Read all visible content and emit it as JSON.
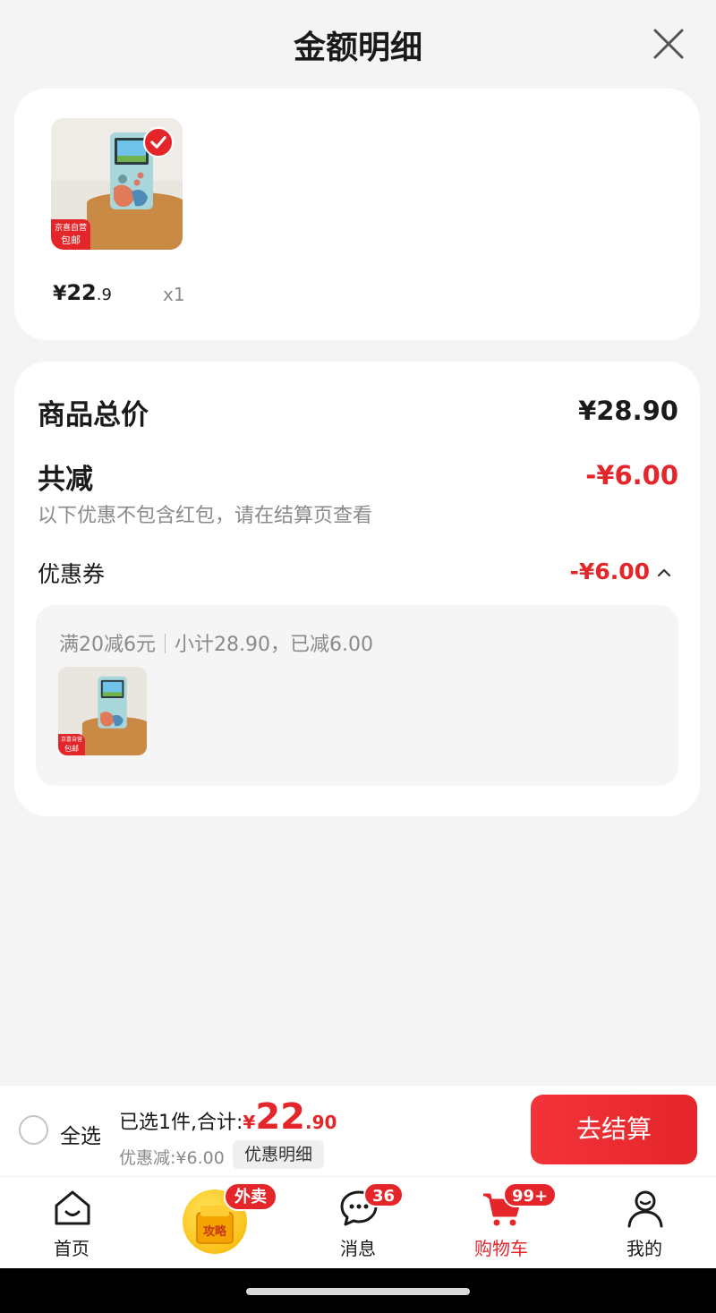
{
  "header": {
    "title": "金额明细",
    "close_icon": "close-icon"
  },
  "product": {
    "price_yen": "¥",
    "price_int": "22",
    "price_dec": ".9",
    "qty": "x1",
    "thumb_icon": "handheld-game-console-image",
    "ship_tag_line1": "京喜自营",
    "ship_tag_line2": "包邮"
  },
  "summary": {
    "total_label": "商品总价",
    "total_value": "¥28.90",
    "reduce_label": "共减",
    "reduce_value": "-¥6.00",
    "reduce_note": "以下优惠不包含红包，请在结算页查看",
    "coupon_label": "优惠券",
    "coupon_value": "-¥6.00",
    "coupon_rule": "满20减6元",
    "coupon_detail": "小计28.90，已减6.00"
  },
  "checkout": {
    "select_all": "全选",
    "selected_prefix": "已选1件,合计:",
    "total_yen": "¥",
    "total_int": "22",
    "total_dec": ".90",
    "discount_text": "优惠减:¥6.00",
    "detail_chip": "优惠明细",
    "button": "去结算"
  },
  "tabbar": {
    "home": "首页",
    "promo_badge": "外卖",
    "promo_text": "攻略",
    "messages": "消息",
    "messages_badge": "36",
    "cart": "购物车",
    "cart_badge": "99+",
    "mine": "我的"
  },
  "colors": {
    "accent": "#e4262b",
    "background": "#f4f4f4"
  }
}
